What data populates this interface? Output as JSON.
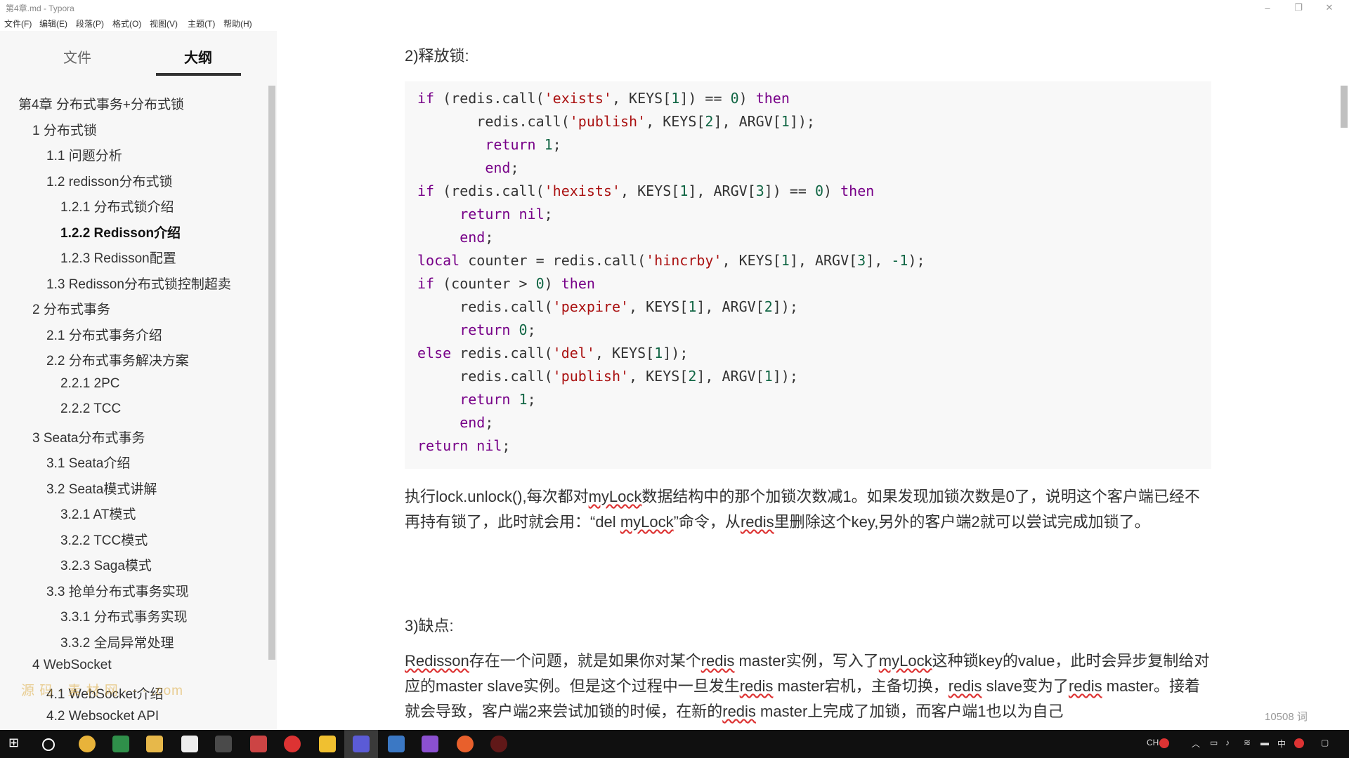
{
  "window": {
    "title": "第4章.md - Typora"
  },
  "menu": [
    "文件(F)",
    "编辑(E)",
    "段落(P)",
    "格式(O)",
    "视图(V)",
    "主题(T)",
    "帮助(H)"
  ],
  "sidebar": {
    "tabs": [
      "文件",
      "大纲"
    ],
    "outline": [
      {
        "label": "第4章 分布式事务+分布式锁",
        "level": 0
      },
      {
        "label": "1 分布式锁",
        "level": 1
      },
      {
        "label": "1.1 问题分析",
        "level": 2
      },
      {
        "label": "1.2 redisson分布式锁",
        "level": 2
      },
      {
        "label": "1.2.1 分布式锁介绍",
        "level": 3
      },
      {
        "label": "1.2.2 Redisson介绍",
        "level": 3,
        "current": true
      },
      {
        "label": "1.2.3 Redisson配置",
        "level": 3
      },
      {
        "label": "1.3 Redisson分布式锁控制超卖",
        "level": 2
      },
      {
        "label": "2 分布式事务",
        "level": 1
      },
      {
        "label": "2.1 分布式事务介绍",
        "level": 2
      },
      {
        "label": "2.2 分布式事务解决方案",
        "level": 2
      },
      {
        "label": "2.2.1 2PC",
        "level": 3
      },
      {
        "label": "2.2.2 TCC",
        "level": 3
      },
      {
        "label": "3 Seata分布式事务",
        "level": 1
      },
      {
        "label": "3.1 Seata介绍",
        "level": 2
      },
      {
        "label": "3.2 Seata模式讲解",
        "level": 2
      },
      {
        "label": "3.2.1 AT模式",
        "level": 3
      },
      {
        "label": "3.2.2 TCC模式",
        "level": 3
      },
      {
        "label": "3.2.3 Saga模式",
        "level": 3
      },
      {
        "label": "3.3 抢单分布式事务实现",
        "level": 2
      },
      {
        "label": "3.3.1 分布式事务实现",
        "level": 3
      },
      {
        "label": "3.3.2 全局异常处理",
        "level": 3
      },
      {
        "label": "4 WebSocket",
        "level": 1
      },
      {
        "label": "4.1 WebSocket介绍",
        "level": 2
      },
      {
        "label": "4.2 Websocket API",
        "level": 2
      }
    ],
    "watermark": "源 码 · 素 材 网 · · · .com"
  },
  "main": {
    "heading_release": "2)释放锁:",
    "code": [
      [
        [
          "kw",
          "if"
        ],
        [
          "p",
          " (redis.call("
        ],
        [
          "str",
          "'exists'"
        ],
        [
          "p",
          ", KEYS["
        ],
        [
          "num",
          "1"
        ],
        [
          "p",
          "]) == "
        ],
        [
          "num",
          "0"
        ],
        [
          "p",
          ") "
        ],
        [
          "kw",
          "then"
        ]
      ],
      [
        [
          "p",
          "       redis.call("
        ],
        [
          "str",
          "'publish'"
        ],
        [
          "p",
          ", KEYS["
        ],
        [
          "num",
          "2"
        ],
        [
          "p",
          "], ARGV["
        ],
        [
          "num",
          "1"
        ],
        [
          "p",
          "]);"
        ]
      ],
      [
        [
          "p",
          "        "
        ],
        [
          "kw",
          "return"
        ],
        [
          "p",
          " "
        ],
        [
          "num",
          "1"
        ],
        [
          "p",
          ";"
        ]
      ],
      [
        [
          "p",
          "        "
        ],
        [
          "kw",
          "end"
        ],
        [
          "p",
          ";"
        ]
      ],
      [
        [
          "kw",
          "if"
        ],
        [
          "p",
          " (redis.call("
        ],
        [
          "str",
          "'hexists'"
        ],
        [
          "p",
          ", KEYS["
        ],
        [
          "num",
          "1"
        ],
        [
          "p",
          "], ARGV["
        ],
        [
          "num",
          "3"
        ],
        [
          "p",
          "]) == "
        ],
        [
          "num",
          "0"
        ],
        [
          "p",
          ") "
        ],
        [
          "kw",
          "then"
        ]
      ],
      [
        [
          "p",
          "     "
        ],
        [
          "kw",
          "return"
        ],
        [
          "p",
          " "
        ],
        [
          "kw",
          "nil"
        ],
        [
          "p",
          ";"
        ]
      ],
      [
        [
          "p",
          "     "
        ],
        [
          "kw",
          "end"
        ],
        [
          "p",
          ";"
        ]
      ],
      [
        [
          "kw",
          "local"
        ],
        [
          "p",
          " counter = redis.call("
        ],
        [
          "str",
          "'hincrby'"
        ],
        [
          "p",
          ", KEYS["
        ],
        [
          "num",
          "1"
        ],
        [
          "p",
          "], ARGV["
        ],
        [
          "num",
          "3"
        ],
        [
          "p",
          "], "
        ],
        [
          "num",
          "-1"
        ],
        [
          "p",
          ");"
        ]
      ],
      [
        [
          "kw",
          "if"
        ],
        [
          "p",
          " (counter > "
        ],
        [
          "num",
          "0"
        ],
        [
          "p",
          ") "
        ],
        [
          "kw",
          "then"
        ]
      ],
      [
        [
          "p",
          "     redis.call("
        ],
        [
          "str",
          "'pexpire'"
        ],
        [
          "p",
          ", KEYS["
        ],
        [
          "num",
          "1"
        ],
        [
          "p",
          "], ARGV["
        ],
        [
          "num",
          "2"
        ],
        [
          "p",
          "]);"
        ]
      ],
      [
        [
          "p",
          "     "
        ],
        [
          "kw",
          "return"
        ],
        [
          "p",
          " "
        ],
        [
          "num",
          "0"
        ],
        [
          "p",
          ";"
        ]
      ],
      [
        [
          "kw",
          "else"
        ],
        [
          "p",
          " redis.call("
        ],
        [
          "str",
          "'del'"
        ],
        [
          "p",
          ", KEYS["
        ],
        [
          "num",
          "1"
        ],
        [
          "p",
          "]);"
        ]
      ],
      [
        [
          "p",
          "     redis.call("
        ],
        [
          "str",
          "'publish'"
        ],
        [
          "p",
          ", KEYS["
        ],
        [
          "num",
          "2"
        ],
        [
          "p",
          "], ARGV["
        ],
        [
          "num",
          "1"
        ],
        [
          "p",
          "]);"
        ]
      ],
      [
        [
          "p",
          "     "
        ],
        [
          "kw",
          "return"
        ],
        [
          "p",
          " "
        ],
        [
          "num",
          "1"
        ],
        [
          "p",
          ";"
        ]
      ],
      [
        [
          "p",
          "     "
        ],
        [
          "kw",
          "end"
        ],
        [
          "p",
          ";"
        ]
      ],
      [
        [
          "kw",
          "return"
        ],
        [
          "p",
          " "
        ],
        [
          "kw",
          "nil"
        ],
        [
          "p",
          ";"
        ]
      ]
    ],
    "para1": [
      [
        "t",
        "执行lock.unlock(),每次都对"
      ],
      [
        "u",
        "myLock"
      ],
      [
        "t",
        "数据结构中的那个加锁次数减1。如果发现加锁次数是0了，说明这个客户端已经不再持有锁了，此时就会用：“del "
      ],
      [
        "u",
        "myLock"
      ],
      [
        "t",
        "”命令，从"
      ],
      [
        "u",
        "redis"
      ],
      [
        "t",
        "里删除这个key,另外的客户端2就可以尝试完成加锁了。"
      ]
    ],
    "heading_drawback": "3)缺点:",
    "para2": [
      [
        "u",
        "Redisson"
      ],
      [
        "t",
        "存在一个问题，就是如果你对某个"
      ],
      [
        "u",
        "redis"
      ],
      [
        "t",
        " master实例，写入了"
      ],
      [
        "u",
        "myLock"
      ],
      [
        "t",
        "这种锁key的value，此时会异步复制给对应的master slave实例。但是这个过程中一旦发生"
      ],
      [
        "u",
        "redis"
      ],
      [
        "t",
        " master宕机，主备切换，"
      ],
      [
        "u",
        "redis"
      ],
      [
        "t",
        " slave变为了"
      ],
      [
        "u",
        "redis"
      ],
      [
        "t",
        " master。接着就会导致，客户端2来尝试加锁的时候，在新的"
      ],
      [
        "u",
        "redis"
      ],
      [
        "t",
        " master上完成了加锁，而客户端1也以为自己"
      ]
    ],
    "word_count": "10508 词"
  },
  "taskbar": {
    "tray_lang": "中",
    "tray_ch": "CH"
  }
}
